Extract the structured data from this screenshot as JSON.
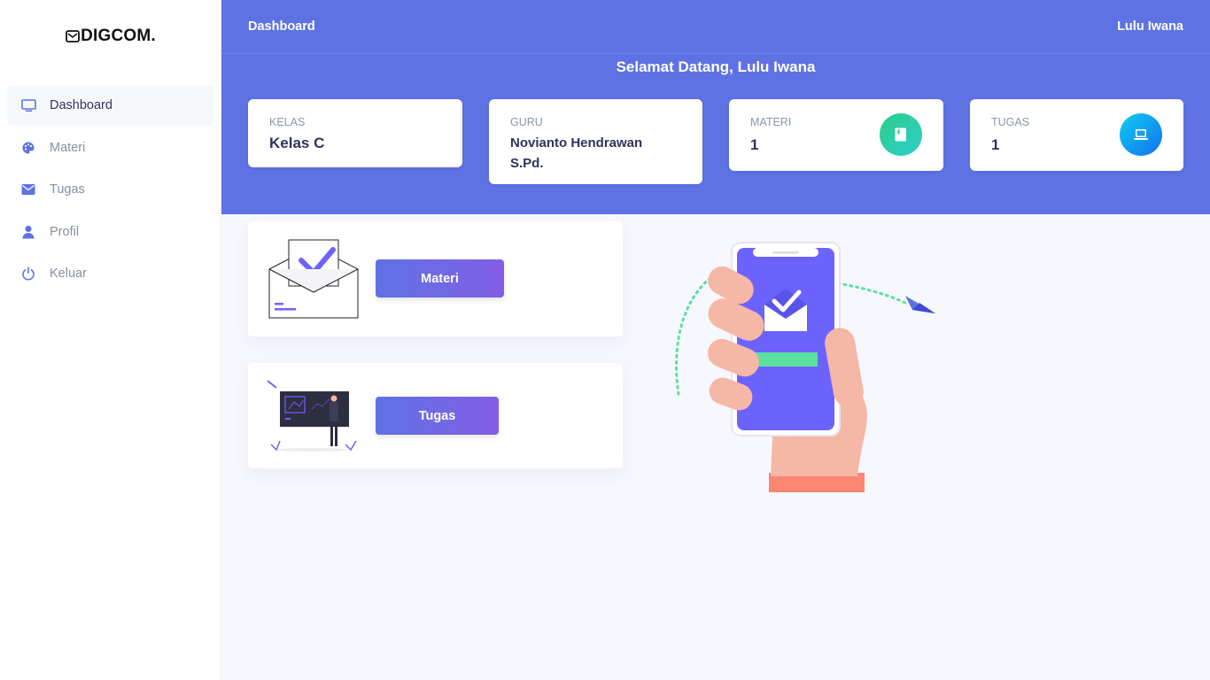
{
  "brand": {
    "name": "DIGCOM."
  },
  "sidebar": {
    "items": [
      {
        "label": "Dashboard",
        "icon": "monitor-icon",
        "active": true
      },
      {
        "label": "Materi",
        "icon": "palette-icon",
        "active": false
      },
      {
        "label": "Tugas",
        "icon": "envelope-icon",
        "active": false
      },
      {
        "label": "Profil",
        "icon": "user-icon",
        "active": false
      },
      {
        "label": "Keluar",
        "icon": "power-icon",
        "active": false
      }
    ]
  },
  "header": {
    "breadcrumb": "Dashboard",
    "user_name": "Lulu Iwana",
    "welcome": "Selamat Datang, Lulu Iwana"
  },
  "stats": {
    "kelas": {
      "caption": "KELAS",
      "value": "Kelas C"
    },
    "guru": {
      "caption": "GURU",
      "value": "Novianto Hendrawan S.Pd."
    },
    "materi": {
      "caption": "MATERI",
      "value": "1",
      "icon": "book-icon",
      "color": "#2dce89"
    },
    "tugas": {
      "caption": "TUGAS",
      "value": "1",
      "icon": "laptop-icon",
      "color": "#11cdef"
    }
  },
  "panels": {
    "materi_button": "Materi",
    "tugas_button": "Tugas"
  },
  "colors": {
    "primary": "#5e72e4",
    "accent": "#825ee4"
  }
}
